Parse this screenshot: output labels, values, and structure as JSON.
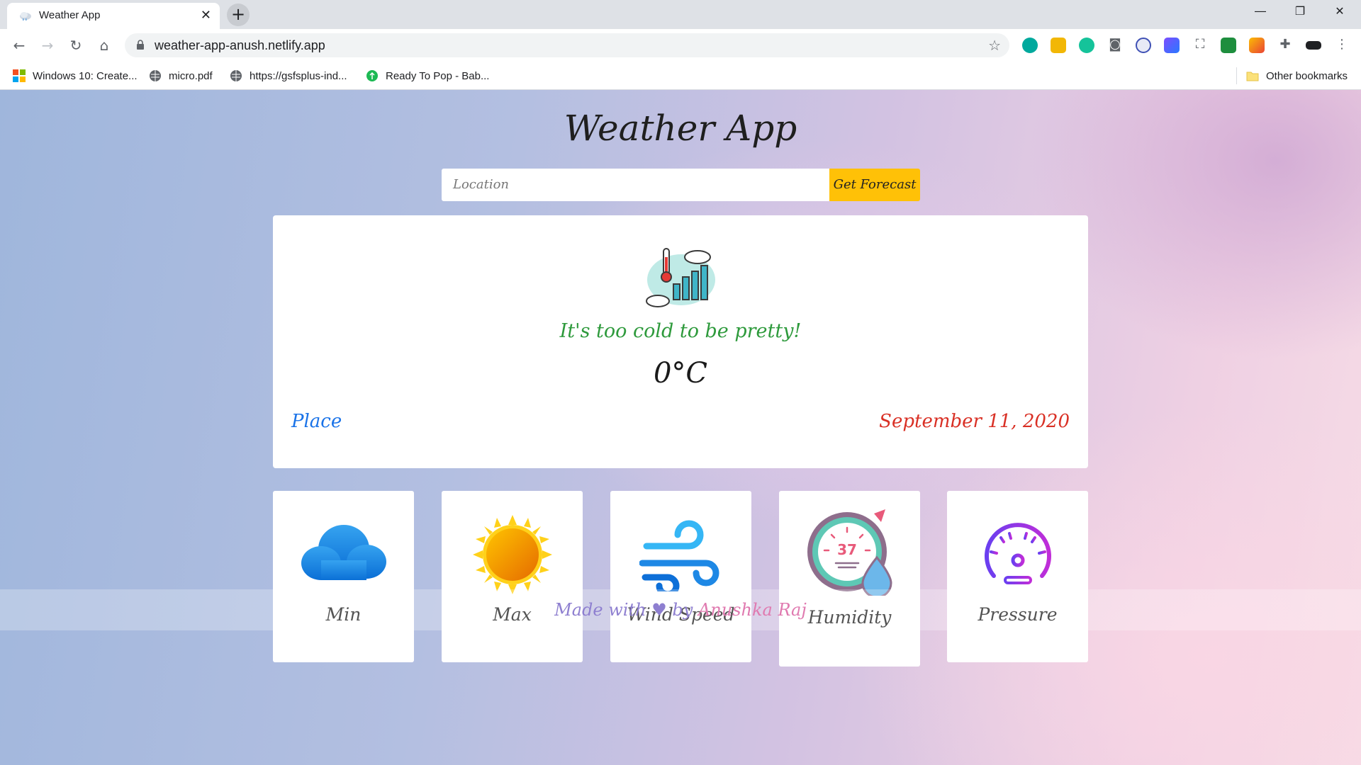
{
  "browser": {
    "tab_title": "Weather App",
    "tab_close": "✕",
    "new_tab": "+",
    "url": "weather-app-anush.netlify.app",
    "bookmarks": [
      {
        "label": "Windows 10: Create..."
      },
      {
        "label": "micro.pdf"
      },
      {
        "label": "https://gsfsplus-ind..."
      },
      {
        "label": "Ready To Pop - Bab..."
      }
    ],
    "other_bookmarks": "Other bookmarks"
  },
  "app": {
    "title": "Weather App",
    "search_placeholder": "Location",
    "forecast_button": "Get Forecast",
    "caption": "It's too cold to be pretty!",
    "temperature": "0°C",
    "place": "Place",
    "date": "September 11, 2020",
    "stats": [
      {
        "label": "Min",
        "icon": "cloud-icon"
      },
      {
        "label": "Max",
        "icon": "sun-icon"
      },
      {
        "label": "Wind Speed",
        "icon": "wind-icon"
      },
      {
        "label": "Humidity",
        "icon": "humidity-gauge-icon"
      },
      {
        "label": "Pressure",
        "icon": "pressure-gauge-icon"
      }
    ],
    "footer": {
      "prefix": "Made with",
      "heart": "♥",
      "by": "by",
      "author": "Anushka Raj"
    }
  },
  "colors": {
    "accent_button": "#ffc107",
    "caption": "#2e9a3c",
    "place": "#1a73e8",
    "date": "#d93025"
  }
}
